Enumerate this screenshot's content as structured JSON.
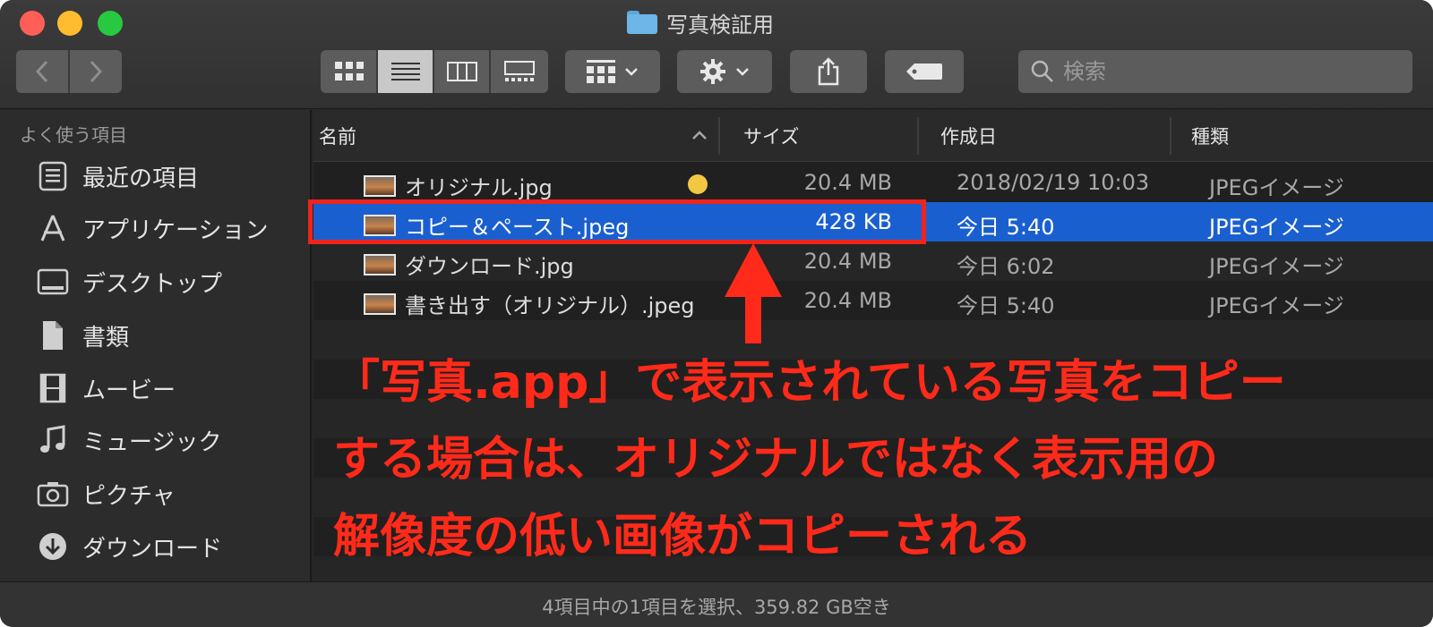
{
  "window": {
    "title": "写真検証用",
    "controls": [
      "close",
      "minimize",
      "zoom"
    ]
  },
  "toolbar": {
    "back_icon": "chevron-left-icon",
    "forward_icon": "chevron-right-icon",
    "view_modes": [
      "icon-view",
      "list-view",
      "column-view",
      "gallery-view"
    ],
    "active_view": "list-view",
    "group_icon": "group-grid-icon",
    "action_icon": "gear-icon",
    "share_icon": "share-icon",
    "tag_icon": "tag-icon",
    "search_placeholder": "検索"
  },
  "sidebar": {
    "heading": "よく使う項目",
    "items": [
      {
        "label": "最近の項目",
        "icon": "recents-icon"
      },
      {
        "label": "アプリケーション",
        "icon": "applications-icon"
      },
      {
        "label": "デスクトップ",
        "icon": "desktop-icon"
      },
      {
        "label": "書類",
        "icon": "documents-icon"
      },
      {
        "label": "ムービー",
        "icon": "movies-icon"
      },
      {
        "label": "ミュージック",
        "icon": "music-icon"
      },
      {
        "label": "ピクチャ",
        "icon": "pictures-icon"
      },
      {
        "label": "ダウンロード",
        "icon": "downloads-icon"
      }
    ]
  },
  "file_list": {
    "columns": {
      "name": "名前",
      "size": "サイズ",
      "created": "作成日",
      "kind": "種類"
    },
    "sort_icon": "chevron-up-icon",
    "rows": [
      {
        "name": "オリジナル.jpg",
        "size": "20.4 MB",
        "created": "2018/02/19 10:03",
        "kind": "JPEGイメージ",
        "tag": "yellow",
        "selected": false
      },
      {
        "name": "コピー＆ペースト.jpeg",
        "size": "428 KB",
        "created": "今日 5:40",
        "kind": "JPEGイメージ",
        "tag": null,
        "selected": true
      },
      {
        "name": "ダウンロード.jpg",
        "size": "20.4 MB",
        "created": "今日 6:02",
        "kind": "JPEGイメージ",
        "tag": null,
        "selected": false
      },
      {
        "name": "書き出す（オリジナル）.jpeg",
        "size": "20.4 MB",
        "created": "今日 5:40",
        "kind": "JPEGイメージ",
        "tag": null,
        "selected": false
      }
    ]
  },
  "annotation": {
    "lines": [
      "「写真.app」で表示されている写真をコピー",
      "する場合は、オリジナルではなく表示用の",
      "解像度の低い画像がコピーされる"
    ],
    "color": "#ff2a1a"
  },
  "status_bar": {
    "text": "4項目中の1項目を選択、359.82 GB空き"
  },
  "colors": {
    "selection": "#1a5fd0",
    "tag_yellow": "#f2c741",
    "annotation_red": "#ff2a1a"
  }
}
